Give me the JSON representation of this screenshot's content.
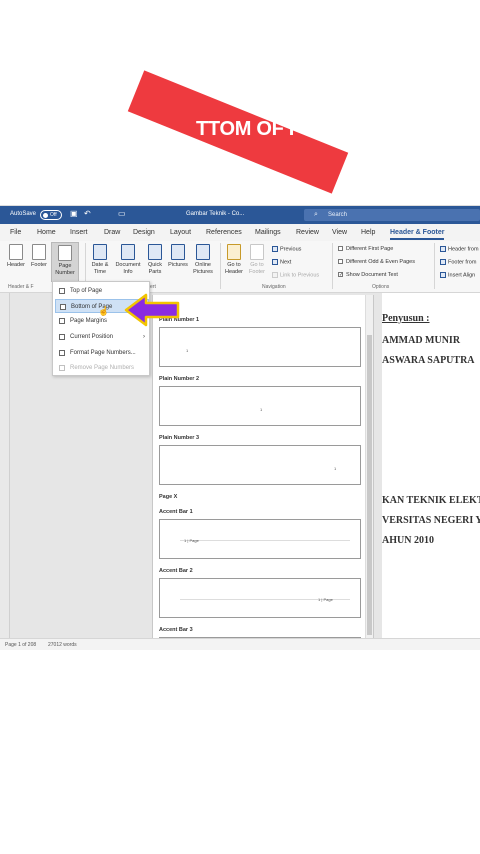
{
  "banner": {
    "text": "TTOM OF P",
    "color": "#ee3a3f"
  },
  "titlebar": {
    "autosave_label": "AutoSave",
    "autosave_state": "Off",
    "doc_title": "Gambar Teknik - Co...",
    "search_placeholder": "Search"
  },
  "menu": [
    "File",
    "Home",
    "Insert",
    "Draw",
    "Design",
    "Layout",
    "References",
    "Mailings",
    "Review",
    "View",
    "Help",
    "Header & Footer"
  ],
  "ribbon": {
    "header": "Header",
    "footer": "Footer",
    "page_number_1": "Page",
    "page_number_2": "Number",
    "group_header_footer": "Header & F",
    "date_time_1": "Date &",
    "date_time_2": "Time",
    "doc_info_1": "Document",
    "doc_info_2": "Info",
    "quick_parts_1": "Quick",
    "quick_parts_2": "Parts",
    "pictures": "Pictures",
    "online_pictures_1": "Online",
    "online_pictures_2": "Pictures",
    "group_insert": "ert",
    "goto_header_1": "Go to",
    "goto_header_2": "Header",
    "goto_footer_1": "Go to",
    "goto_footer_2": "Footer",
    "previous": "Previous",
    "next": "Next",
    "link_previous": "Link to Previous",
    "group_navigation": "Navigation",
    "diff_first_page": "Different First Page",
    "diff_odd_even": "Different Odd & Even Pages",
    "show_doc_text": "Show Document Text",
    "group_options": "Options",
    "header_from_top": "Header from",
    "footer_from_bottom": "Footer from",
    "insert_alignment": "Insert Align"
  },
  "dropdown": {
    "items": [
      {
        "label": "Top of Page"
      },
      {
        "label": "Bottom of Page"
      },
      {
        "label": "Page Margins"
      },
      {
        "label": "Current Position"
      },
      {
        "label": "Format Page Numbers..."
      },
      {
        "label": "Remove Page Numbers"
      }
    ]
  },
  "gallery": {
    "label_plain1": "Plain Number 1",
    "label_plain2": "Plain Number 2",
    "label_plain3": "Plain Number 3",
    "section_page_x": "Page X",
    "label_accent1": "Accent Bar 1",
    "label_accent2": "Accent Bar 2",
    "label_accent3": "Accent Bar 3",
    "mark_plain1": "1",
    "mark_plain2": "1",
    "mark_plain3": "1",
    "accent1_text": "1 | Page",
    "accent2_text": "1 | Page"
  },
  "document": {
    "line1": "Penyusun :",
    "line2": "AMMAD MUNIR",
    "line3": "ASWARA SAPUTRA",
    "line4": "KAN TEKNIK ELEKT",
    "line5": "VERSITAS NEGERI Y",
    "line6": "AHUN 2010"
  },
  "status": {
    "page": "Page 1 of 208",
    "words": "27012 words"
  }
}
